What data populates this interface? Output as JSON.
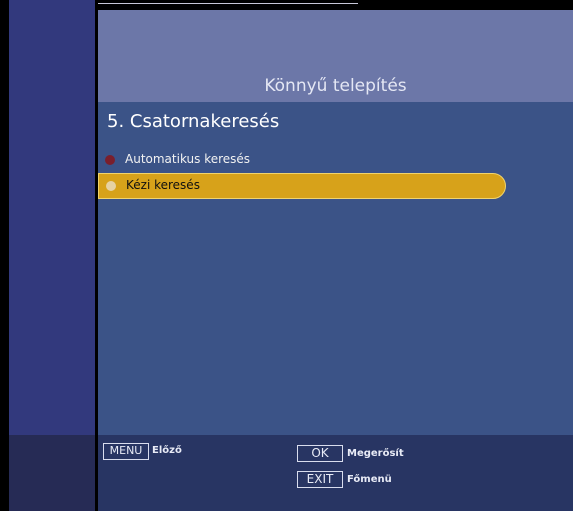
{
  "header": {
    "title": "Könnyű telepítés"
  },
  "main": {
    "section_title": "5. Csatornakeresés",
    "items": [
      {
        "label": "Automatikus keresés",
        "selected": false
      },
      {
        "label": "Kézi keresés",
        "selected": true
      }
    ]
  },
  "footer": {
    "menu_key": "MENU",
    "menu_label": "Előző",
    "ok_key": "OK",
    "ok_label": "Megerősít",
    "exit_key": "EXIT",
    "exit_label": "Főmenü"
  },
  "colors": {
    "selected_bg": "#d7a21a",
    "panel_bg": "#3b5387",
    "header_bg": "#6c77a8"
  }
}
